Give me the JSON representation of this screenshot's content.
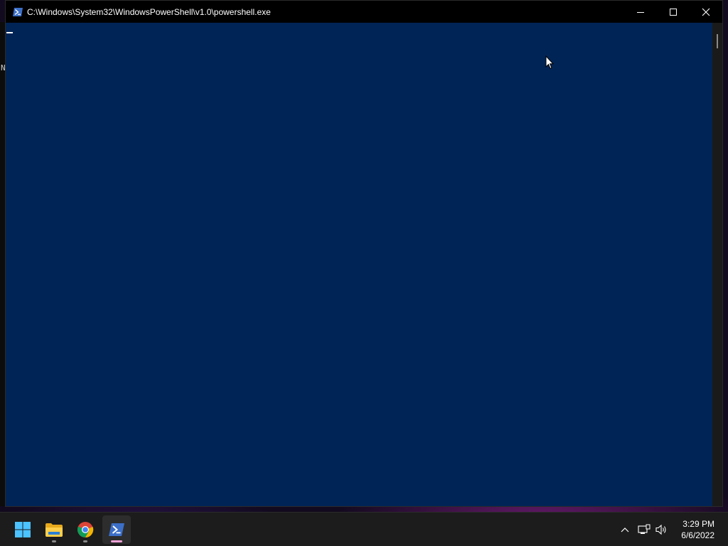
{
  "window": {
    "title": "C:\\Windows\\System32\\WindowsPowerShell\\v1.0\\powershell.exe",
    "icon": "powershell-icon",
    "console_background": "#012456",
    "caption_buttons": [
      "minimize-icon",
      "maximize-icon",
      "close-icon"
    ]
  },
  "behind_window": {
    "partial_text": "N"
  },
  "taskbar": {
    "apps": [
      {
        "name": "Start",
        "icon": "windows-logo-icon"
      },
      {
        "name": "File Explorer",
        "icon": "folder-icon"
      },
      {
        "name": "Google Chrome",
        "icon": "chrome-icon"
      },
      {
        "name": "Windows PowerShell",
        "icon": "powershell-icon",
        "active": true
      }
    ],
    "tray": {
      "icons": [
        "chevron-up-icon",
        "network-icon",
        "volume-icon"
      ]
    },
    "clock": {
      "time": "3:29 PM",
      "date": "6/6/2022"
    }
  }
}
